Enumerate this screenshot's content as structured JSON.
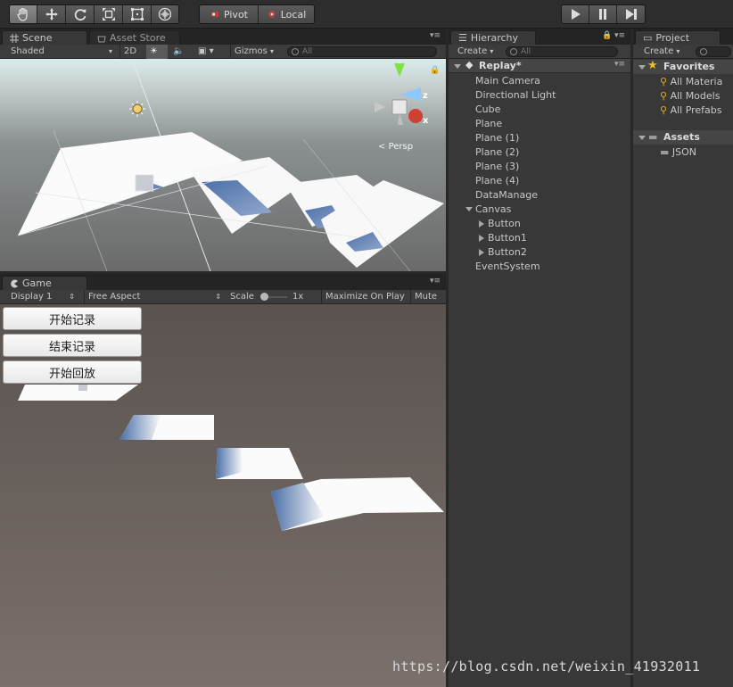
{
  "toolbar": {
    "tools": [
      {
        "name": "hand-tool",
        "icon": "hand-icon",
        "active": true
      },
      {
        "name": "move-tool",
        "icon": "move-icon"
      },
      {
        "name": "rotate-tool",
        "icon": "rotate-icon"
      },
      {
        "name": "scale-tool",
        "icon": "scale-icon"
      },
      {
        "name": "rect-tool",
        "icon": "rect-icon"
      },
      {
        "name": "transform-tool",
        "icon": "transform-icon"
      }
    ],
    "pivot_label": "Pivot",
    "local_label": "Local",
    "play_icon": "play-icon",
    "pause_icon": "pause-icon",
    "step_icon": "step-icon"
  },
  "scene": {
    "tab_label": "Scene",
    "asset_store_label": "Asset Store",
    "shading_mode": "Shaded",
    "mode_2d_label": "2D",
    "gizmos_label": "Gizmos",
    "search_placeholder": "All",
    "persp_label": "Persp",
    "gizmo_axis_z": "z",
    "gizmo_axis_x": "x"
  },
  "game": {
    "tab_label": "Game",
    "display_label": "Display 1",
    "aspect_label": "Free Aspect",
    "scale_label": "Scale",
    "scale_value": "1x",
    "maximize_label": "Maximize On Play",
    "mute_label": "Mute A",
    "buttons": [
      "开始记录",
      "结束记录",
      "开始回放"
    ]
  },
  "hierarchy": {
    "tab_label": "Hierarchy",
    "create_label": "Create",
    "search_placeholder": "All",
    "scene_name": "Replay*",
    "items": [
      "Main Camera",
      "Directional Light",
      "Cube",
      "Plane",
      "Plane (1)",
      "Plane (2)",
      "Plane (3)",
      "Plane (4)",
      "DataManage",
      "Canvas",
      "Button",
      "Button1",
      "Button2",
      "EventSystem"
    ]
  },
  "project": {
    "tab_label": "Project",
    "create_label": "Create",
    "favorites_label": "Favorites",
    "favorites": [
      "All Materia",
      "All Models",
      "All Prefabs"
    ],
    "assets_label": "Assets",
    "folders": [
      "JSON"
    ]
  },
  "watermark": "https://blog.csdn.net/weixin_41932011",
  "colors": {
    "panel_bg": "#383838",
    "game_ground": "#6e6461",
    "scene_sky": "#9aa0a3",
    "favorite_star": "#f0c020",
    "search_yellow": "#e0b020"
  }
}
